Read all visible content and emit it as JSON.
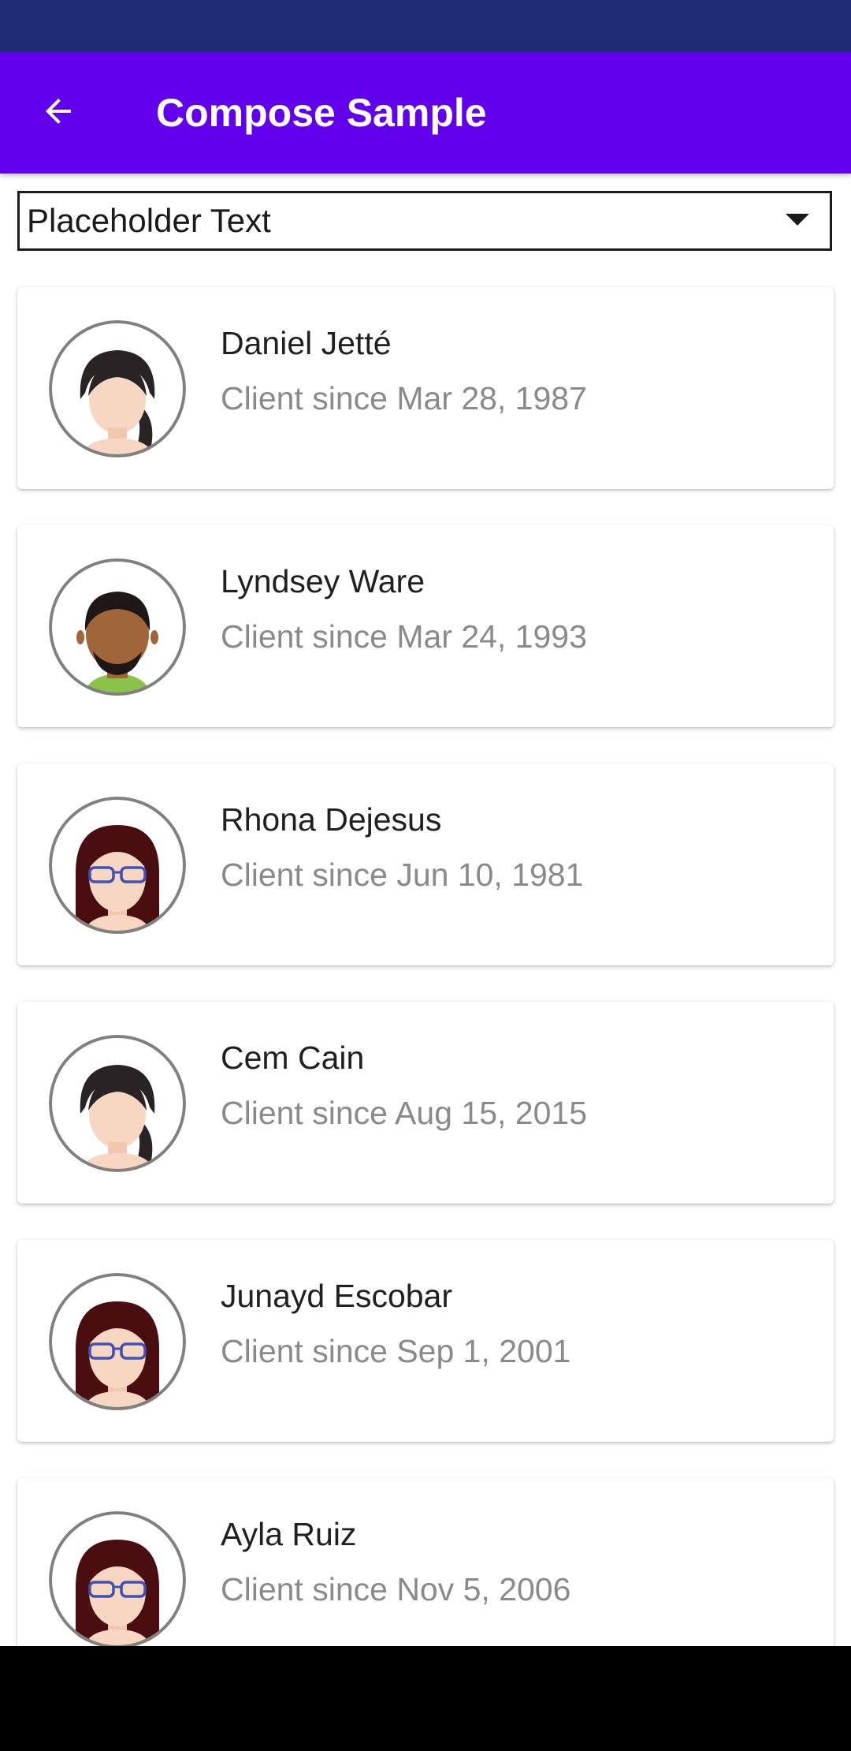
{
  "app_bar": {
    "title": "Compose Sample",
    "back_icon": "arrow-back-icon"
  },
  "dropdown": {
    "value": "Placeholder Text",
    "icon": "arrow-drop-down-icon"
  },
  "clients": [
    {
      "name": "Daniel Jetté",
      "since": "Client since Mar 28, 1987",
      "avatar": "woman-braid"
    },
    {
      "name": "Lyndsey Ware",
      "since": "Client since Mar 24, 1993",
      "avatar": "man-beard"
    },
    {
      "name": "Rhona Dejesus",
      "since": "Client since Jun 10, 1981",
      "avatar": "woman-glasses"
    },
    {
      "name": "Cem Cain",
      "since": "Client since Aug 15, 2015",
      "avatar": "woman-braid"
    },
    {
      "name": "Junayd Escobar",
      "since": "Client since Sep 1, 2001",
      "avatar": "woman-glasses"
    },
    {
      "name": "Ayla Ruiz",
      "since": "Client since Nov 5, 2006",
      "avatar": "woman-glasses"
    }
  ],
  "colors": {
    "status_bar": "#1f2d74",
    "app_bar": "#6200ee",
    "name_text": "#202020",
    "secondary_text": "#8a8a8a"
  }
}
